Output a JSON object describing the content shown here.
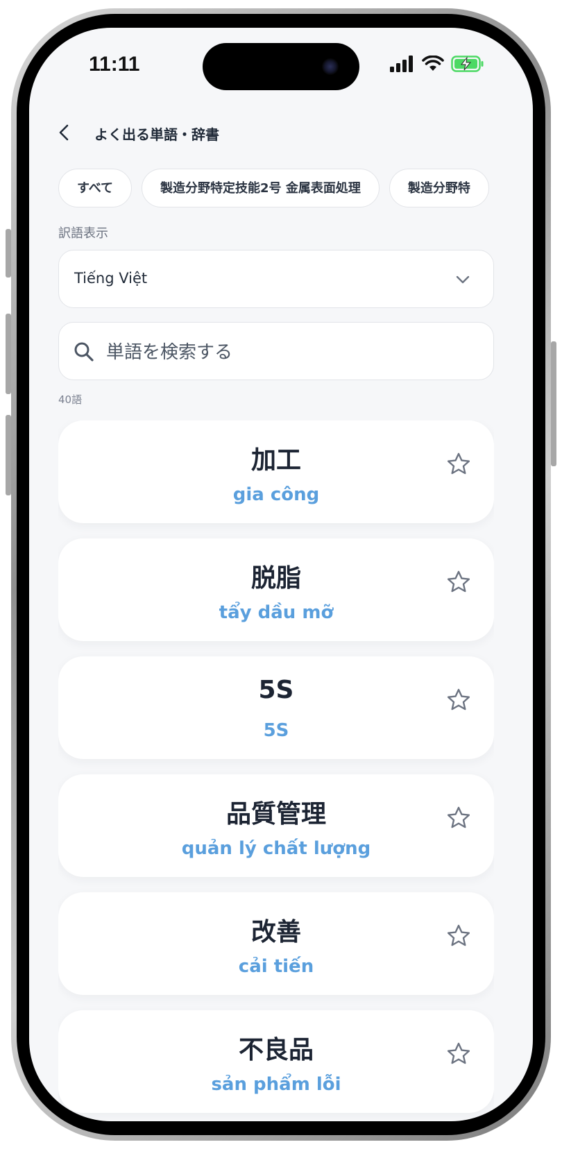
{
  "status_bar": {
    "time": "11:11",
    "icons": [
      "signal-icon",
      "wifi-icon",
      "battery-charging-icon"
    ],
    "battery_color": "#4cd964"
  },
  "header": {
    "back_icon": "chevron-left-icon",
    "title": "よく出る単語・辞書"
  },
  "filters": {
    "chips": [
      {
        "label": "すべて"
      },
      {
        "label": "製造分野特定技能2号 金属表面処理"
      },
      {
        "label": "製造分野特"
      }
    ]
  },
  "translation": {
    "label": "訳語表示",
    "selected": "Tiếng Việt"
  },
  "search": {
    "placeholder": "単語を検索する",
    "value": ""
  },
  "word_count": "40語",
  "words": [
    {
      "term": "加工",
      "translation": "gia công"
    },
    {
      "term": "脱脂",
      "translation": "tẩy dầu mỡ"
    },
    {
      "term": "5S",
      "translation": "5S"
    },
    {
      "term": "品質管理",
      "translation": "quản lý chất lượng"
    },
    {
      "term": "改善",
      "translation": "cải tiến"
    },
    {
      "term": "不良品",
      "translation": "sản phẩm lỗi"
    }
  ],
  "colors": {
    "accent": "#5a9fdd",
    "background": "#f6f7f9",
    "text": "#1c2433"
  }
}
